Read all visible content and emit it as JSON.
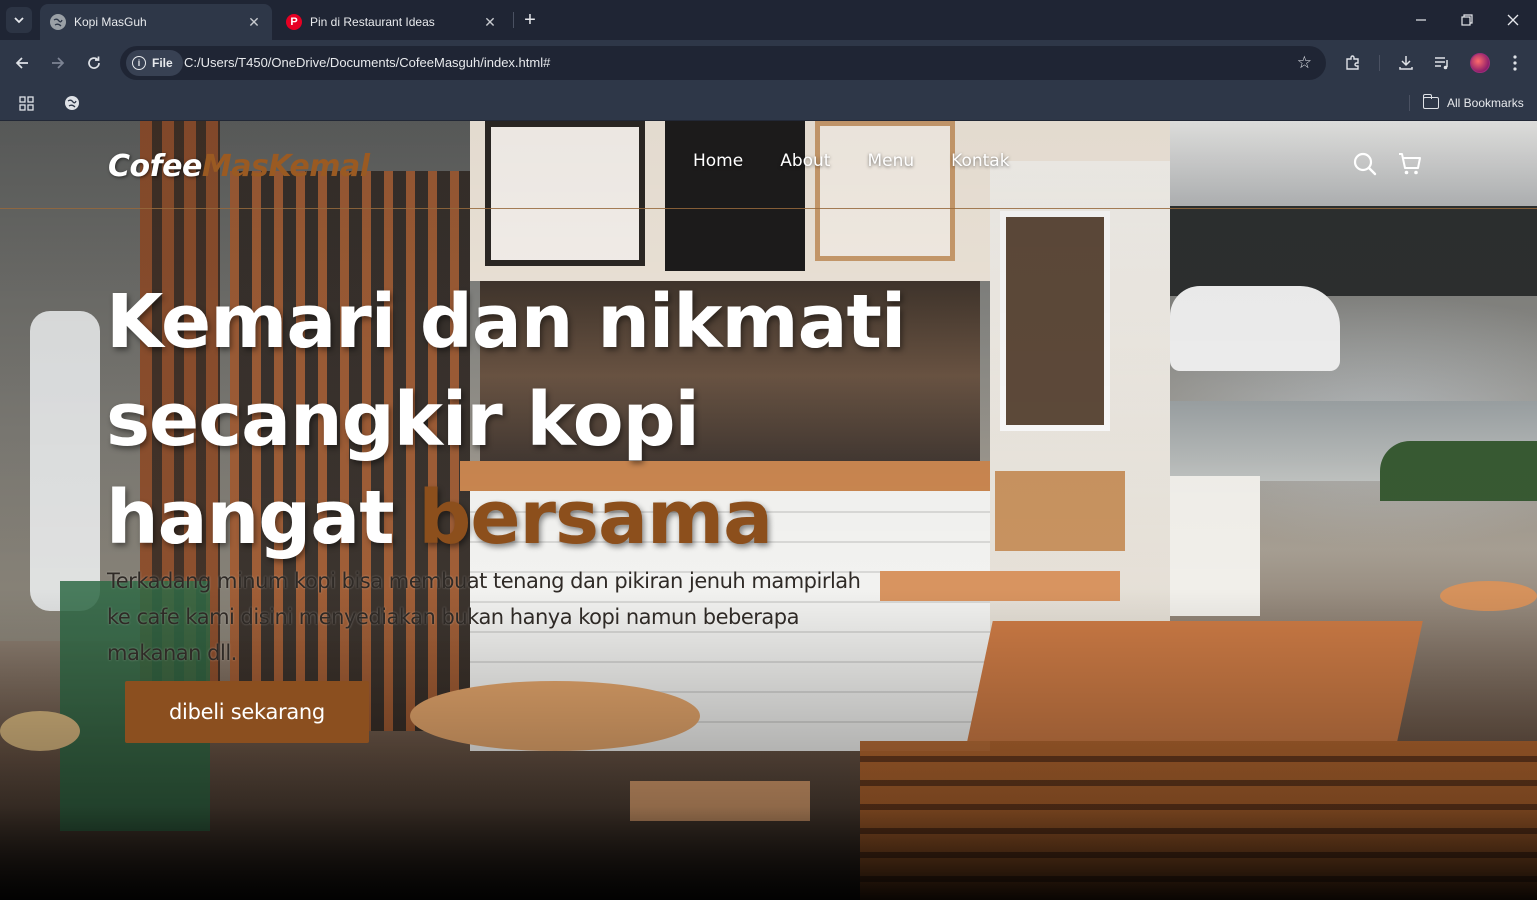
{
  "browser": {
    "tabs": [
      {
        "title": "Kopi MasGuh",
        "active": true,
        "icon": "globe-icon"
      },
      {
        "title": "Pin di Restaurant Ideas",
        "active": false,
        "icon": "pinterest-icon"
      }
    ],
    "address": {
      "scheme_chip": "File",
      "url": "C:/Users/T450/OneDrive/Documents/CofeeMasguh/index.html#"
    },
    "bookmarks_bar": {
      "all_bookmarks": "All Bookmarks"
    }
  },
  "site": {
    "logo": {
      "part1": "Cofee",
      "part2": "MasKemal"
    },
    "nav": [
      "Home",
      "About",
      "Menu",
      "Kontak"
    ],
    "hero": {
      "title_line1": "Kemari dan nikmati",
      "title_line2": "secangkir kopi",
      "title_line3_plain": "hangat ",
      "title_line3_accent": "bersama",
      "description": "Terkadang minum kopi bisa membuat tenang dan pikiran jenuh mampirlah ke cafe kami disini menyediakan bukan hanya kopi namun beberapa makanan dll.",
      "cta": "dibeli sekarang"
    }
  },
  "colors": {
    "accent": "#8b4f1f",
    "nav_border": "#96693c",
    "chrome_dark": "#1f2534",
    "chrome_mid": "#2e3748"
  }
}
